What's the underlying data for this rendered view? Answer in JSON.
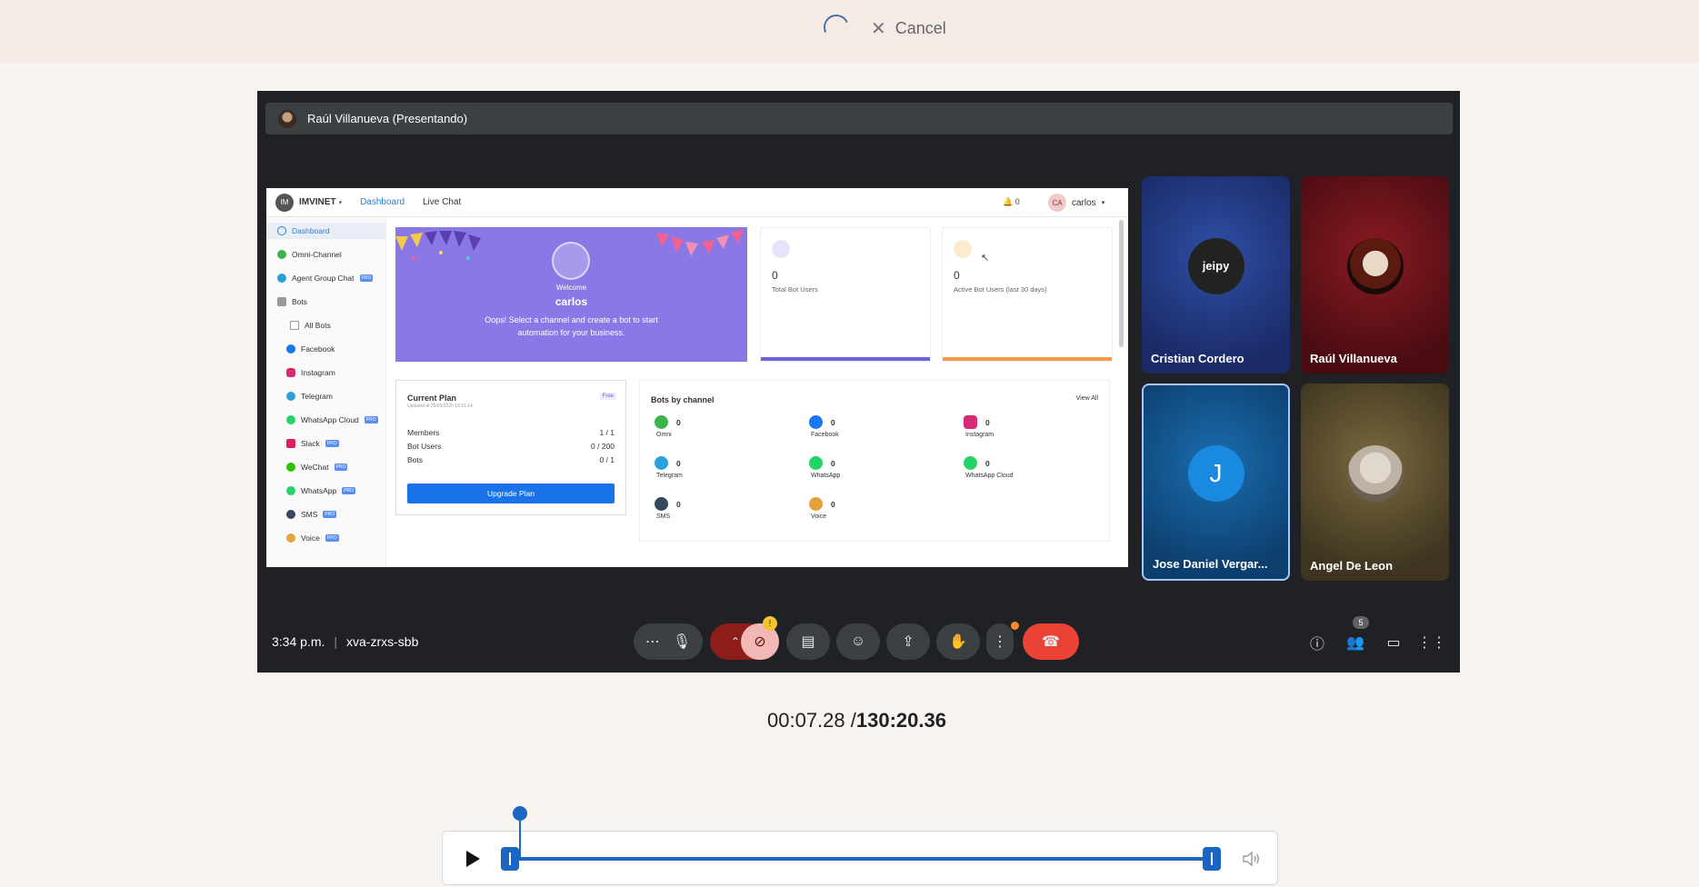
{
  "topbar": {
    "cancel_label": "Cancel"
  },
  "meeting": {
    "presenter_label": "Raúl Villanueva (Presentando)",
    "clock": "3:34 p.m.",
    "meeting_code": "xva-zrxs-sbb",
    "people_count": "5",
    "participants": [
      {
        "name": "Cristian Cordero",
        "avatar_text": "jeipy"
      },
      {
        "name": "Raúl Villanueva",
        "avatar_text": ""
      },
      {
        "name": "Jose Daniel Vergar...",
        "avatar_text": "J"
      },
      {
        "name": "Angel De Leon",
        "avatar_text": ""
      }
    ]
  },
  "shared_screen": {
    "logo_text": "IM",
    "brand": "IMVINET",
    "nav": {
      "dashboard": "Dashboard",
      "live_chat": "Live Chat"
    },
    "notifications": "0",
    "user_initials": "CA",
    "user_name": "carlos",
    "sidebar": [
      "Dashboard",
      "Omni-Channel",
      "Agent Group Chat",
      "Bots",
      "All Bots",
      "Facebook",
      "Instagram",
      "Telegram",
      "WhatsApp Cloud",
      "Slack",
      "WeChat",
      "WhatsApp",
      "SMS",
      "Voice"
    ],
    "pro_badge": "PRO",
    "welcome": {
      "label": "Welcome",
      "name": "carlos",
      "message": "Oops! Select a channel and create a bot to start automation for your business."
    },
    "stats": [
      {
        "value": "0",
        "label": "Total Bot Users"
      },
      {
        "value": "0",
        "label": "Active Bot Users (last 30 days)"
      }
    ],
    "plan": {
      "title": "Current Plan",
      "updated": "Updated at 25/05/2025 19:31:14",
      "badge": "Free",
      "rows": [
        {
          "label": "Members",
          "value": "1 / 1"
        },
        {
          "label": "Bot Users",
          "value": "0 / 200"
        },
        {
          "label": "Bots",
          "value": "0 / 1"
        }
      ],
      "button": "Upgrade Plan"
    },
    "channels": {
      "title": "Bots by channel",
      "view_all": "View All",
      "items": [
        {
          "name": "Omni",
          "count": "0",
          "color": "#3bb54a"
        },
        {
          "name": "Facebook",
          "count": "0",
          "color": "#1877f2"
        },
        {
          "name": "Instagram",
          "count": "0",
          "color": "#d62976"
        },
        {
          "name": "Telegram",
          "count": "0",
          "color": "#2aa1da"
        },
        {
          "name": "WhatsApp",
          "count": "0",
          "color": "#25d366"
        },
        {
          "name": "WhatsApp Cloud",
          "count": "0",
          "color": "#25d366"
        },
        {
          "name": "SMS",
          "count": "0",
          "color": "#34495e"
        },
        {
          "name": "Voice",
          "count": "0",
          "color": "#e4a23b"
        }
      ]
    }
  },
  "player": {
    "current_time": "00:07.28",
    "separator": "/",
    "total_time": "130:20.36"
  },
  "colors": {
    "accent": "#1a66c2",
    "hangup": "#ea4335",
    "welcome_bg": "#8a78e6"
  }
}
